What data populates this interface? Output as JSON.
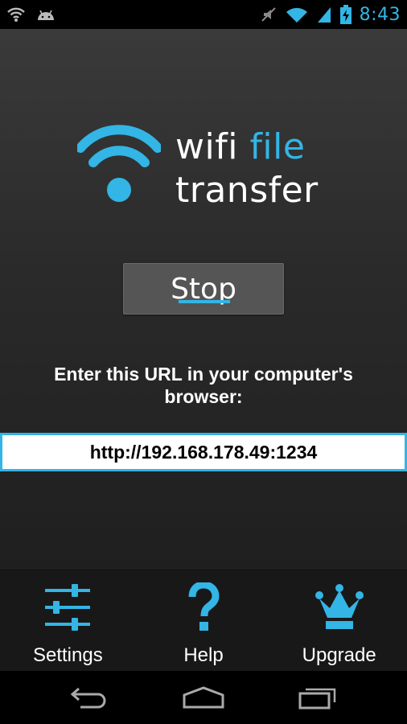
{
  "status_bar": {
    "time": "8:43",
    "left_icons": [
      "wifi-icon",
      "android-icon"
    ],
    "right_icons": [
      "mute-icon",
      "wifi-signal-icon",
      "cell-signal-icon",
      "battery-charging-icon"
    ]
  },
  "logo": {
    "line1_plain": "wifi",
    "line1_accent": "file",
    "line2": "transfer",
    "icon": "wifi-logo-icon"
  },
  "stop_button": {
    "label": "Stop"
  },
  "instruction": {
    "text": "Enter this URL in your computer's browser:"
  },
  "url": {
    "value": "http://192.168.178.49:1234"
  },
  "action_bar": {
    "items": [
      {
        "label": "Settings",
        "icon": "sliders-icon"
      },
      {
        "label": "Help",
        "icon": "question-icon"
      },
      {
        "label": "Upgrade",
        "icon": "crown-icon"
      }
    ]
  },
  "nav_bar": {
    "buttons": [
      "back-icon",
      "home-icon",
      "recent-apps-icon"
    ]
  },
  "colors": {
    "accent": "#33b5e5",
    "background_top": "#3a3a3a",
    "background_bottom": "#1f1f1f",
    "action_bar": "#181818"
  }
}
